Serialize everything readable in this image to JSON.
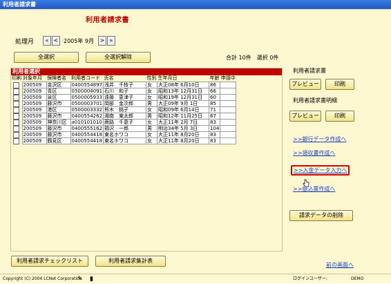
{
  "window": {
    "title": "利用者請求書"
  },
  "page": {
    "title": "利用者請求書"
  },
  "period": {
    "label": "処理月",
    "value": "2005年 9月",
    "first": "«",
    "prev": "<",
    "next": ">",
    "last": "»"
  },
  "actions": {
    "select_all": "全選択",
    "deselect_all": "全選択解除"
  },
  "summary": {
    "text": "合計 10件　選択 0件"
  },
  "grid": {
    "header": "利用者選択",
    "columns": [
      "印刷",
      "対象年月",
      "保険者名",
      "利用者コード",
      "氏名",
      "性別",
      "生年月日",
      "年齢",
      "申請中"
    ],
    "rows": [
      [
        "200509",
        "金沢区",
        "0400554897",
        "浅井　千枝子",
        "女",
        "大正08年 6月10日",
        "86",
        ""
      ],
      [
        "200509",
        "青区",
        "0500004091",
        "石川　和子",
        "女",
        "昭和13年 12月31日",
        "66",
        ""
      ],
      [
        "200509",
        "泉区",
        "0500005933",
        "遠藤　恵津子",
        "女",
        "昭和19年 12月31日",
        "60",
        ""
      ],
      [
        "200509",
        "藤沢市",
        "0500003701",
        "岡部　金次郎",
        "男",
        "大正09年 9月 1日",
        "85",
        ""
      ],
      [
        "200509",
        "港区",
        "0500003332",
        "熊木　桃子",
        "女",
        "昭和09年 6月14日",
        "71",
        ""
      ],
      [
        "200509",
        "藤沢市",
        "0400554262",
        "湘南　東太郎",
        "男",
        "昭和12年 11月25日",
        "67",
        ""
      ],
      [
        "200509",
        "神奈川区",
        "a010101010",
        "蕨路　千恵子",
        "女",
        "大正11年 2月 7日",
        "83",
        ""
      ],
      [
        "200509",
        "藤沢市",
        "0400555162",
        "鶏沢　一郎",
        "男",
        "明治34年 5月 3日",
        "104",
        ""
      ],
      [
        "200509",
        "藤沢市",
        "0400554418",
        "東名ホワコ",
        "女",
        "大正11年 8月20日",
        "83",
        ""
      ],
      [
        "200509",
        "鶴見区",
        "0400554418",
        "東名ホワコ",
        "女",
        "大正11年 8月20日",
        "83",
        ""
      ]
    ]
  },
  "sidebar": {
    "invoice_label": "利用者請求書",
    "detail_label": "利用者請求書明細",
    "preview": "プレビュー",
    "print": "印刷",
    "link_bank": ">>銀行データ作成へ",
    "link_receipt": ">>領収書作成へ",
    "link_deposit": ">>入金データ入力へ",
    "link_transfer": ">>振込票作成へ",
    "delete_button": "請求データの削除"
  },
  "footer": {
    "checklist_button": "利用者請求チェックリスト",
    "summary_button": "利用者請求集計表",
    "back_link": "前の画面へ"
  },
  "statusbar": {
    "copyright": "Copyright (C) 2004 LCNet Corporation",
    "user_label": "ログインユーザー:",
    "user_value": "DEMO"
  }
}
